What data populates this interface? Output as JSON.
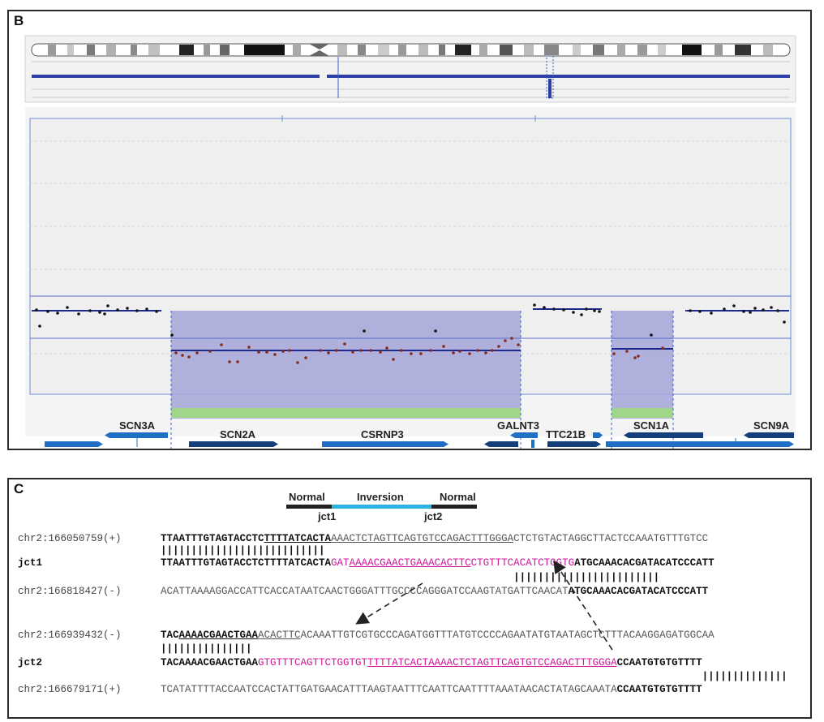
{
  "panelB": {
    "label": "B",
    "genes": [
      "SCN3A",
      "SCN2A",
      "CSRNP3",
      "GALNT3",
      "TTC21B",
      "SCN1A",
      "SCN9A"
    ]
  },
  "panelC": {
    "label": "C",
    "legend": {
      "normal_left": "Normal",
      "inversion": "Inversion",
      "normal_right": "Normal",
      "jct1": "jct1",
      "jct2": "jct2"
    },
    "rows": [
      {
        "label": "chr2:166050759(+)",
        "parts": [
          {
            "t": "TTAATTTGTAGTACCTC",
            "c": "b"
          },
          {
            "t": "TTTTATCACTA",
            "c": "b u"
          },
          {
            "t": "AAACTCTAGTTCAGTGTCCAGACTTTGGGA",
            "c": "g u"
          },
          {
            "t": "CTCTGTACTAGGCTTACTCCAAATGTTTGTCC",
            "c": "g"
          }
        ]
      },
      {
        "label": "",
        "parts": [
          {
            "t": "|||||||||||||||||||||||||||",
            "c": "b"
          }
        ]
      },
      {
        "label": "jct1",
        "bold": true,
        "parts": [
          {
            "t": "TTAATTTGTAGTACCTCTTTTATCACTA",
            "c": "b"
          },
          {
            "t": "GAT",
            "c": "m"
          },
          {
            "t": "AAAACGAACTGAAACACTTC",
            "c": "m u"
          },
          {
            "t": "CTGTTTCACATCTGGTG",
            "c": "m"
          },
          {
            "t": "ATGCAAACACGATACATCCCATT",
            "c": "b"
          }
        ]
      },
      {
        "label": "",
        "parts": [
          {
            "t": "                                                          ||||||||||||||||||||||||",
            "c": "b"
          }
        ]
      },
      {
        "label": "chr2:166818427(-)",
        "parts": [
          {
            "t": "ACATTAAAAGGACCATTCACCATAATCAACTGGGATTTGCCCCAGGGATCCAAGTATGATTCAACAT",
            "c": "g"
          },
          {
            "t": "ATGCAAACACGATACATCCCATT",
            "c": "b"
          }
        ]
      },
      {
        "label": "chr2:166939432(-)",
        "parts": [
          {
            "t": "TAC",
            "c": "b"
          },
          {
            "t": "AAAACGAACTGAA",
            "c": "b u"
          },
          {
            "t": "ACACTTC",
            "c": "g u"
          },
          {
            "t": "ACAAATTGTCGTGCCCAGATGGTTTATGTCCCCAGAATATGTAATAGCTCTTTACAAGGAGATGGCAA",
            "c": "g"
          }
        ]
      },
      {
        "label": "",
        "parts": [
          {
            "t": "|||||||||||||||",
            "c": "b"
          }
        ]
      },
      {
        "label": "jct2",
        "bold": true,
        "parts": [
          {
            "t": "TACAAAACGAACTGAA",
            "c": "b"
          },
          {
            "t": "GTGTTTCAGTTCTGGTGT",
            "c": "m"
          },
          {
            "t": "TTTTATCACTAAAACTCTAGTTCAGTGTCCAGACTTTGGGA",
            "c": "m u"
          },
          {
            "t": "CCAATGTGTGTTTT",
            "c": "b"
          }
        ]
      },
      {
        "label": "",
        "parts": [
          {
            "t": "                                                                                         ||||||||||||||",
            "c": "b"
          }
        ]
      },
      {
        "label": "chr2:166679171(+)",
        "parts": [
          {
            "t": "TCATATTTTACCAATCCACTATTGATGAACATTTAAGTAATTTCAATTCAATTTTAAATAACACTATAGCAAATA",
            "c": "g"
          },
          {
            "t": "CCAATGTGTGTTTT",
            "c": "b"
          }
        ]
      }
    ]
  }
}
